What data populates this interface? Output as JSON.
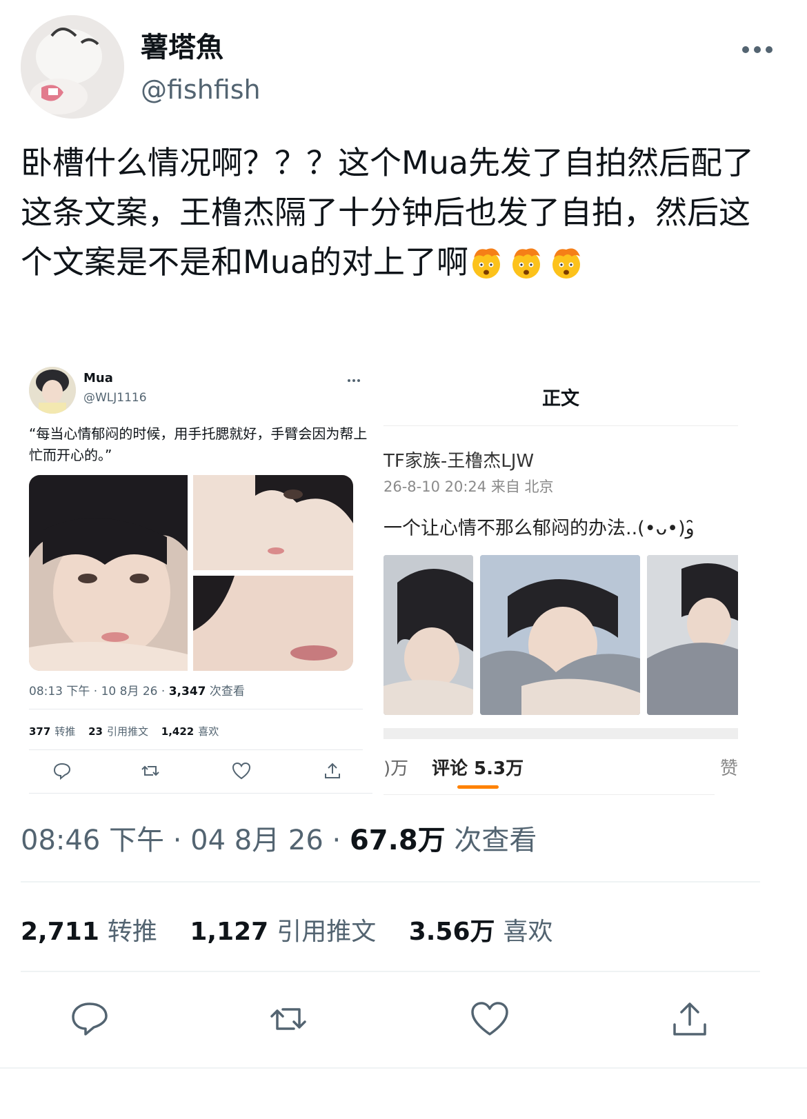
{
  "author": {
    "display_name": "薯塔魚",
    "handle": "@fishfish"
  },
  "tweet": {
    "text": "卧槽什么情况啊？？？这个Mua先发了自拍然后配了这条文案，王橹杰隔了十分钟后也发了自拍，然后这个文案是不是和Mua的对上了啊",
    "emoji_name": "exploding-head-emoji"
  },
  "embedded_tweet": {
    "name": "Mua",
    "handle": "@WLJ1116",
    "text": "“每当心情郁闷的时候，用手托腮就好，手臂会因为帮上忙而开心的。”",
    "time": "08:13 下午 · 10 8月 26 · ",
    "views": "3,347",
    "views_label": " 次查看",
    "retweets": "377",
    "retweets_label": "转推",
    "quotes": "23",
    "quotes_label": "引用推文",
    "likes": "1,422",
    "likes_label": "喜欢"
  },
  "weibo": {
    "title": "正文",
    "author": "TF家族-王橹杰LJW",
    "time": "26-8-10 20:24  来自 北京",
    "text": "一个让心情不那么郁闷的办法..(•ᴗ•)و ̑̑",
    "tab_left": ")万",
    "tab_active": "评论 5.3万",
    "tab_right": "赞",
    "accent": "#ff8200"
  },
  "meta": {
    "time": "08:46 下午 · 04 8月 26 · ",
    "views": "67.8万",
    "views_label": " 次查看"
  },
  "stats": {
    "retweets": "2,711",
    "retweets_label": "转推",
    "quotes": "1,127",
    "quotes_label": "引用推文",
    "likes": "3.56万",
    "likes_label": "喜欢"
  },
  "icons": {
    "reply": "reply-icon",
    "retweet": "retweet-icon",
    "like": "heart-icon",
    "share": "share-icon"
  }
}
